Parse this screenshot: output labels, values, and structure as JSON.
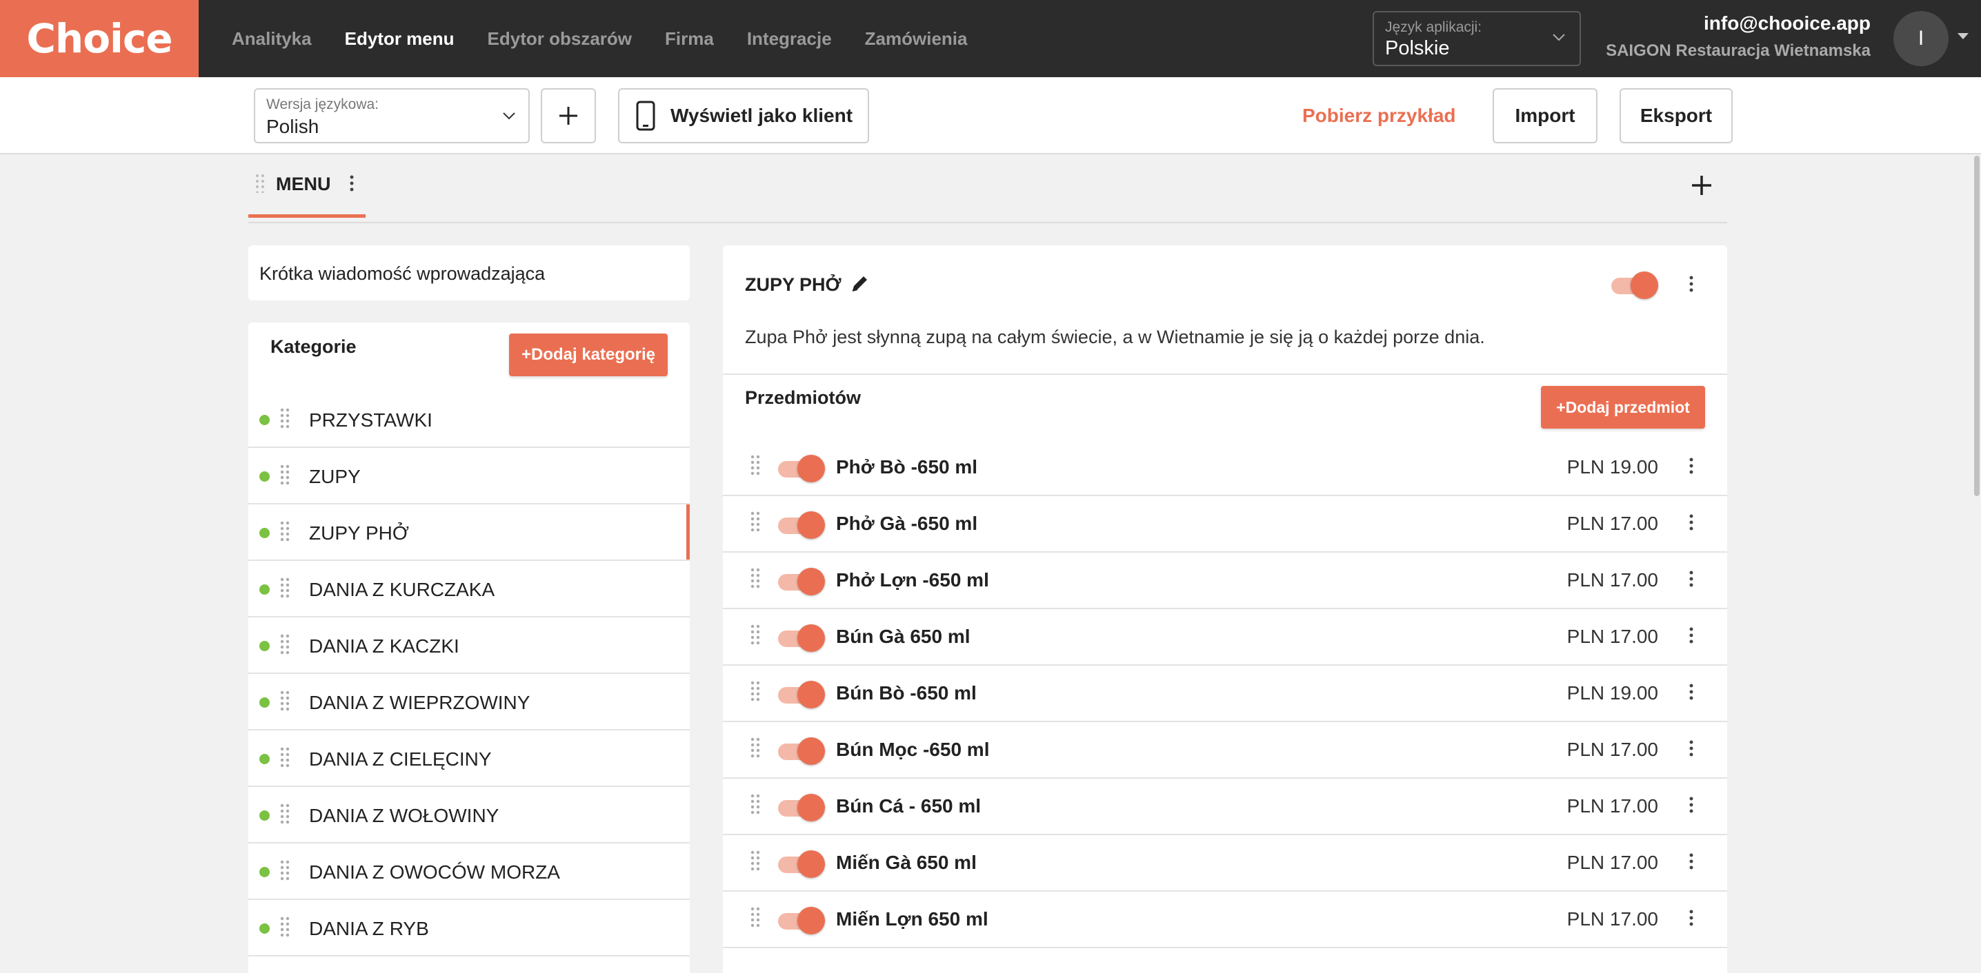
{
  "app": {
    "logo": "Choice",
    "nav": [
      "Analityka",
      "Edytor menu",
      "Edytor obszarów",
      "Firma",
      "Integracje",
      "Zamówienia"
    ],
    "active_nav": "Edytor menu",
    "app_language": {
      "label": "Język aplikacji:",
      "value": "Polskie"
    },
    "account": {
      "email": "info@chooice.app",
      "restaurant": "SAIGON Restauracja Wietnamska",
      "avatar_initial": "I"
    }
  },
  "toolbar": {
    "language_version": {
      "label": "Wersja językowa:",
      "value": "Polish"
    },
    "view_as_client": "Wyświetl jako klient",
    "download_sample": "Pobierz przykład",
    "import": "Import",
    "export": "Eksport"
  },
  "menu_tab": {
    "label": "MENU"
  },
  "intro": "Krótka wiadomość wprowadzająca",
  "categories": {
    "title": "Kategorie",
    "add_button": "+Dodaj kategorię",
    "items": [
      {
        "label": "PRZYSTAWKI",
        "active": false
      },
      {
        "label": "ZUPY",
        "active": false
      },
      {
        "label": "ZUPY PHỞ",
        "active": true
      },
      {
        "label": "DANIA Z KURCZAKA",
        "active": false
      },
      {
        "label": "DANIA Z KACZKI",
        "active": false
      },
      {
        "label": "DANIA Z WIEPRZOWINY",
        "active": false
      },
      {
        "label": "DANIA Z CIELĘCINY",
        "active": false
      },
      {
        "label": "DANIA Z WOŁOWINY",
        "active": false
      },
      {
        "label": "DANIA Z OWOCÓW MORZA",
        "active": false
      },
      {
        "label": "DANIA Z RYB",
        "active": false
      }
    ]
  },
  "category_detail": {
    "title": "ZUPY PHỞ",
    "enabled": true,
    "description": "Zupa Phở jest słynną zupą na całym świecie, a w Wietnamie je się ją o każdej porze dnia.",
    "items_title": "Przedmiotów",
    "add_item_button": "+Dodaj przedmiot",
    "items": [
      {
        "name": "Phở Bò -650 ml",
        "price": "PLN 19.00",
        "enabled": true
      },
      {
        "name": "Phở Gà -650 ml",
        "price": "PLN 17.00",
        "enabled": true
      },
      {
        "name": "Phở Lợn -650 ml",
        "price": "PLN 17.00",
        "enabled": true
      },
      {
        "name": "Bún Gà 650 ml",
        "price": "PLN 17.00",
        "enabled": true
      },
      {
        "name": "Bún Bò -650 ml",
        "price": "PLN 19.00",
        "enabled": true
      },
      {
        "name": "Bún Mọc -650 ml",
        "price": "PLN 17.00",
        "enabled": true
      },
      {
        "name": "Bún Cá - 650 ml",
        "price": "PLN 17.00",
        "enabled": true
      },
      {
        "name": "Miến Gà 650 ml",
        "price": "PLN 17.00",
        "enabled": true
      },
      {
        "name": "Miến Lợn 650 ml",
        "price": "PLN 17.00",
        "enabled": true
      }
    ]
  },
  "colors": {
    "accent": "#ea6f52",
    "accent_light": "#f4b8a8",
    "status_green": "#7bc142",
    "topbar": "#2c2c2c"
  }
}
